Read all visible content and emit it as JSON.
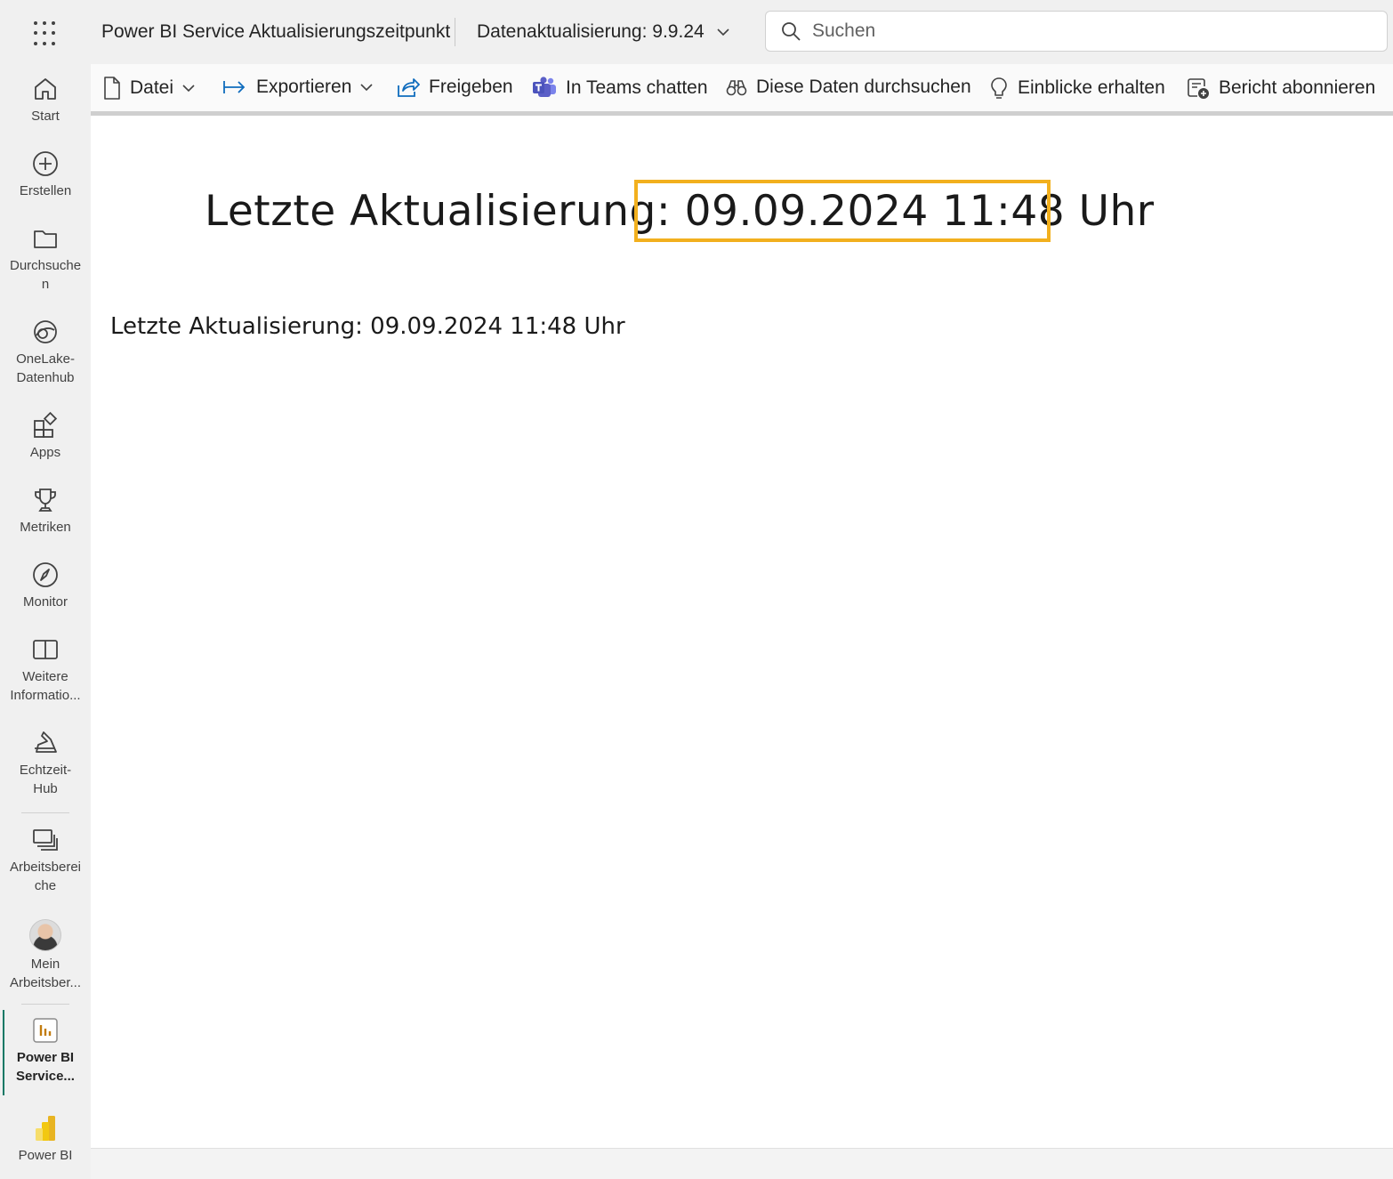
{
  "header": {
    "app_title": "Power BI Service Aktualisierungszeitpunkt",
    "refresh_label": "Datenaktualisierung: 9.9.24",
    "search_placeholder": "Suchen"
  },
  "nav": [
    {
      "label": "Start"
    },
    {
      "label": "Erstellen"
    },
    {
      "label": "Durchsuche n"
    },
    {
      "label": "OneLake-Datenhub"
    },
    {
      "label": "Apps"
    },
    {
      "label": "Metriken"
    },
    {
      "label": "Monitor"
    },
    {
      "label": "Weitere Informatio..."
    },
    {
      "label": "Echtzeit-Hub"
    },
    {
      "label": "Arbeitsberei che"
    },
    {
      "label": "Mein Arbeitsber..."
    },
    {
      "label": "Power BI Service..."
    },
    {
      "label": "Power BI"
    }
  ],
  "toolbar": {
    "file": "Datei",
    "export": "Exportieren",
    "share": "Freigeben",
    "teams": "In Teams chatten",
    "explore": "Diese Daten durchsuchen",
    "insights": "Einblicke erhalten",
    "subscribe": "Bericht abonnieren"
  },
  "report": {
    "headline_label": "Letzte Aktualisierung:",
    "headline_value": "09.09.2024 11:48 Uhr",
    "subline": "Letzte Aktualisierung: 09.09.2024 11:48 Uhr"
  },
  "colors": {
    "highlight": "#f2b01e",
    "active_nav": "#117865",
    "accent_blue": "#0f6cbd",
    "teams_purple": "#5b5fc7"
  }
}
